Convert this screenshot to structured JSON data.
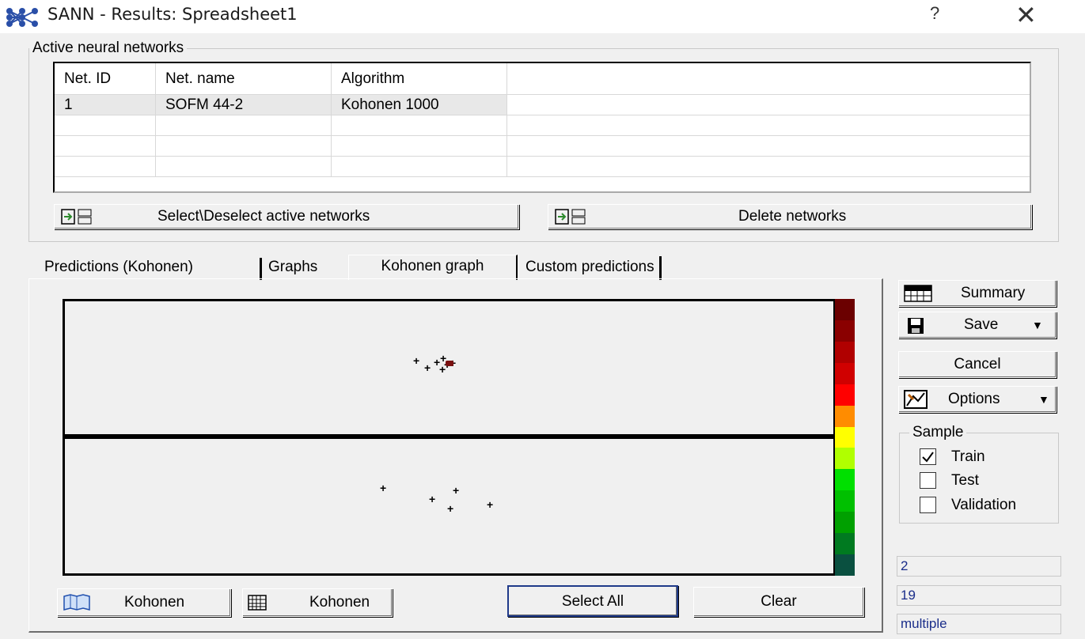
{
  "window": {
    "title": "SANN - Results: Spreadsheet1",
    "help": "?",
    "close": "✕"
  },
  "networks": {
    "legend": "Active neural networks",
    "columns": [
      "Net. ID",
      "Net. name",
      "Algorithm"
    ],
    "rows": [
      {
        "id": "1",
        "name": "SOFM 44-2",
        "algorithm": "Kohonen 1000"
      }
    ],
    "select_button": "Select\\Deselect active networks",
    "delete_button": "Delete networks"
  },
  "tabs": [
    "Predictions (Kohonen)",
    "Graphs",
    "Kohonen graph",
    "Custom predictions"
  ],
  "active_tab": "Kohonen graph",
  "graph": {
    "scale_colors": [
      "#6b0000",
      "#8a0000",
      "#b00000",
      "#d00000",
      "#ff0000",
      "#ff8c00",
      "#ffff00",
      "#b0ff00",
      "#00e000",
      "#00c000",
      "#00a000",
      "#007a20",
      "#0a5040"
    ]
  },
  "bottom_buttons": {
    "kohonen_1": "Kohonen",
    "kohonen_2": "Kohonen",
    "select_all": "Select All",
    "clear": "Clear"
  },
  "side": {
    "summary": "Summary",
    "save": "Save",
    "cancel": "Cancel",
    "options": "Options",
    "sample_legend": "Sample",
    "train": "Train",
    "test": "Test",
    "validation": "Validation",
    "train_checked": true,
    "test_checked": false,
    "validation_checked": false,
    "field1": "2",
    "field2": "19",
    "field3": "multiple"
  }
}
